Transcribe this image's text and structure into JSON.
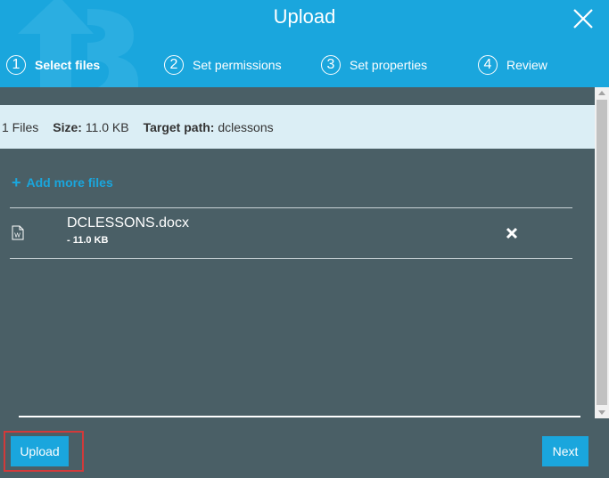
{
  "dialog": {
    "title": "Upload"
  },
  "steps": [
    {
      "number": "1",
      "label": "Select files",
      "active": true
    },
    {
      "number": "2",
      "label": "Set permissions",
      "active": false
    },
    {
      "number": "3",
      "label": "Set properties",
      "active": false
    },
    {
      "number": "4",
      "label": "Review",
      "active": false
    }
  ],
  "summary": {
    "files": "1 Files",
    "size_label": "Size:",
    "size_value": "11.0 KB",
    "path_label": "Target path:",
    "path_value": "dclessons"
  },
  "add_more": {
    "icon": "plus-icon",
    "label": "Add more files"
  },
  "file": {
    "icon": "word-document-icon",
    "name": "DCLESSONS.docx",
    "size": "- 11.0 KB"
  },
  "buttons": {
    "upload": "Upload",
    "next": "Next"
  },
  "colors": {
    "accent": "#1aa6dd",
    "panel": "#4a5f66",
    "highlight": "#d23a3a"
  }
}
